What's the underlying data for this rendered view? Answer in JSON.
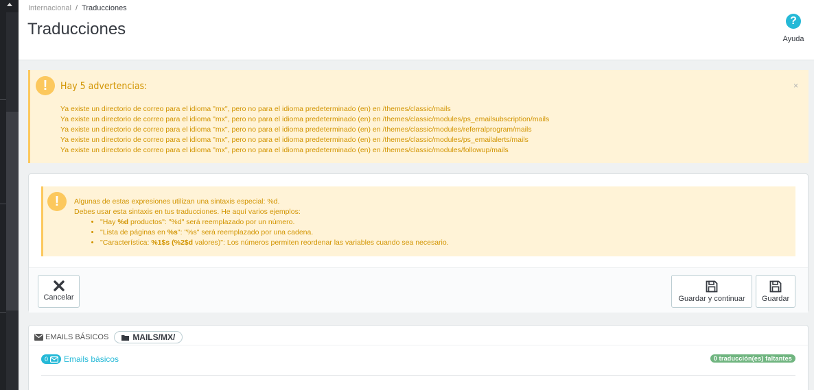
{
  "breadcrumb": {
    "parent": "Internacional",
    "separator": "/",
    "current": "Traducciones"
  },
  "page": {
    "title": "Traducciones"
  },
  "help": {
    "label": "Ayuda",
    "icon": "question-circle-icon"
  },
  "alert": {
    "title": "Hay 5 advertencias:",
    "close_label": "×",
    "messages": [
      "Ya existe un directorio de correo para el idioma \"mx\", pero no para el idioma predeterminado (en) en /themes/classic/mails",
      "Ya existe un directorio de correo para el idioma \"mx\", pero no para el idioma predeterminado (en) en /themes/classic/modules/ps_emailsubscription/mails",
      "Ya existe un directorio de correo para el idioma \"mx\", pero no para el idioma predeterminado (en) en /themes/classic/modules/referralprogram/mails",
      "Ya existe un directorio de correo para el idioma \"mx\", pero no para el idioma predeterminado (en) en /themes/classic/modules/ps_emailalerts/mails",
      "Ya existe un directorio de correo para el idioma \"mx\", pero no para el idioma predeterminado (en) en /themes/classic/modules/followup/mails"
    ]
  },
  "info": {
    "line1": "Algunas de estas expresiones utilizan una sintaxis especial: %d.",
    "line2": "Debes usar esta sintaxis en tus traducciones. He aquí varios ejemplos:",
    "ex1": {
      "pre": "\"Hay ",
      "code": "%d",
      "mid": " productos\": \"%d\" será reemplazado por un número."
    },
    "ex2": {
      "pre": "\"Lista de páginas en ",
      "code": "%s",
      "mid": "\": \"%s\" será reemplazado por una cadena."
    },
    "ex3": {
      "pre": "\"Característica: ",
      "code": "%1$s (%2$d",
      "mid": " valores)\": Los números permiten reordenar las variables cuando sea necesario."
    }
  },
  "toolbar": {
    "cancel_label": "Cancelar",
    "save_continue_label": "Guardar y continuar",
    "save_label": "Guardar"
  },
  "emails_panel": {
    "heading": "EMAILS BÁSICOS",
    "folder": "MAILS/MX/",
    "section_count": "0",
    "section_label": "Emails básicos",
    "missing_badge": "0 traducción(es) faltantes"
  },
  "colors": {
    "accent": "#25b9d7",
    "warning_bg": "#fff3d7",
    "warning_text": "#d29400",
    "success": "#70b580"
  }
}
